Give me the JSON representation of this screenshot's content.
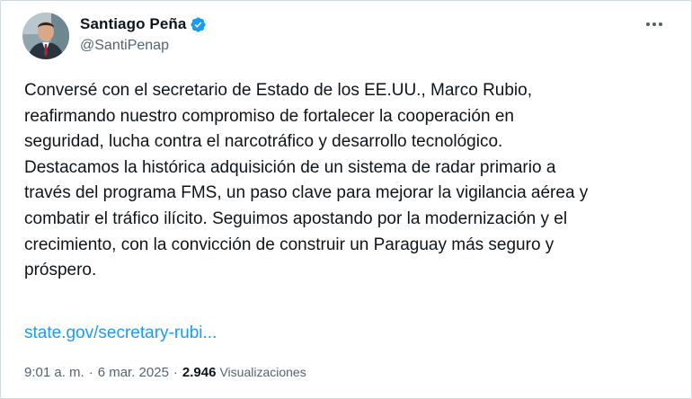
{
  "author": {
    "display_name": "Santiago Peña",
    "handle": "@SantiPenap",
    "verified_badge_icon": "verified-badge-icon",
    "verified_color": "#1d9bf0"
  },
  "tweet": {
    "lines": [
      "Conversé con el secretario de Estado de los EE.UU., Marco Rubio,",
      "reafirmando nuestro compromiso de fortalecer la cooperación en",
      "seguridad, lucha contra el narcotráfico y desarrollo tecnológico.",
      "Destacamos la histórica adquisición de un sistema de radar primario a",
      "través del programa FMS, un paso clave para mejorar la vigilancia aérea y",
      "combatir el tráfico ilícito. Seguimos apostando por la modernización y el",
      "crecimiento, con la convicción de construir un Paraguay más seguro y",
      "próspero."
    ],
    "link_text": "state.gov/secretary-rubi...",
    "link_color": "#1d9bf0"
  },
  "meta": {
    "time": "9:01 a. m.",
    "separator": "·",
    "date": "6 mar. 2025",
    "views_count": "2.946",
    "views_label": "Visualizaciones"
  },
  "menu": {
    "more_icon": "more-options-icon"
  }
}
